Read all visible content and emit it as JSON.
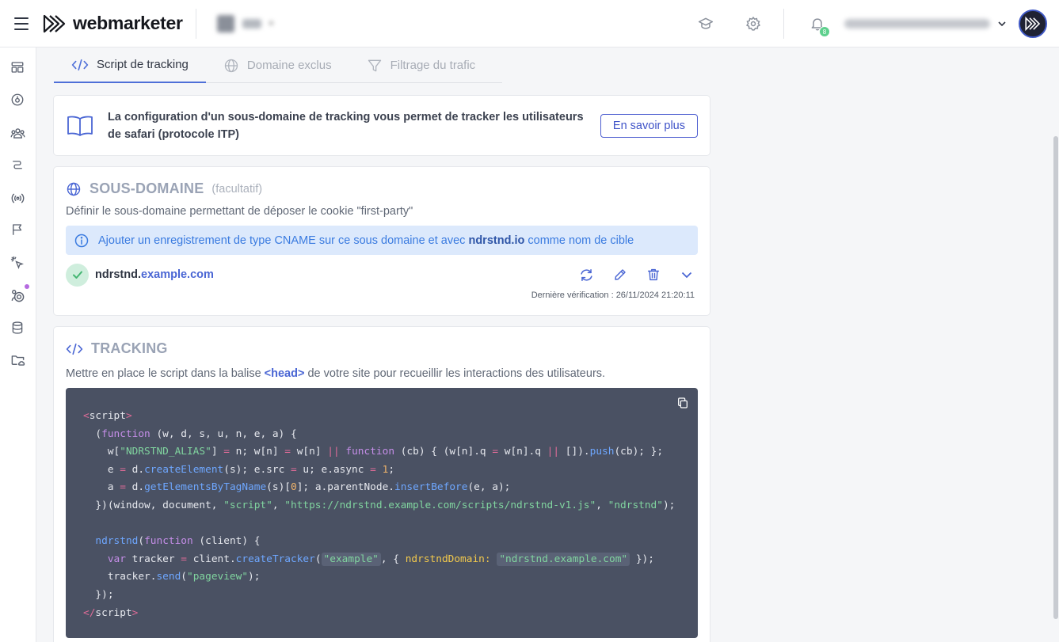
{
  "header": {
    "brand": "webmarketer",
    "notification_count": "8"
  },
  "sidebar": {
    "items": [
      {
        "icon": "dashboard-icon"
      },
      {
        "icon": "gauge-icon"
      },
      {
        "icon": "users-icon"
      },
      {
        "icon": "journey-icon"
      },
      {
        "icon": "broadcast-icon"
      },
      {
        "icon": "flag-icon"
      },
      {
        "icon": "cursor-click-icon"
      },
      {
        "icon": "target-icon"
      },
      {
        "icon": "database-icon"
      },
      {
        "icon": "folder-cloud-icon"
      }
    ]
  },
  "tabs": [
    {
      "label": "Script de tracking",
      "active": true
    },
    {
      "label": "Domaine exclus",
      "active": false
    },
    {
      "label": "Filtrage du trafic",
      "active": false
    }
  ],
  "info_card": {
    "text": "La configuration d'un sous-domaine de tracking vous permet de tracker les utilisateurs de safari (protocole ITP)",
    "button": "En savoir plus"
  },
  "subdomain": {
    "title": "SOUS-DOMAINE",
    "optional": "(facultatif)",
    "description": "Définir le sous-domaine permettant de déposer le cookie \"first-party\"",
    "alert_prefix": "Ajouter un enregistrement de type CNAME sur ce sous domaine et avec",
    "alert_target": "ndrstnd.io",
    "alert_suffix": "comme nom de cible",
    "domain_prefix": "ndrstnd.",
    "domain_suffix": "example.com",
    "last_check": "Dernière vérification : 26/11/2024 21:20:11"
  },
  "tracking": {
    "title": "TRACKING",
    "desc_prefix": "Mettre en place le script dans la balise",
    "desc_tag": "<head>",
    "desc_suffix": "de votre site pour recueillir les interactions des utilisateurs."
  },
  "colors": {
    "accent": "#4e6fd8",
    "code_bg": "#4a5163",
    "alert_bg": "#dce9fc",
    "success": "#5ed08d"
  }
}
